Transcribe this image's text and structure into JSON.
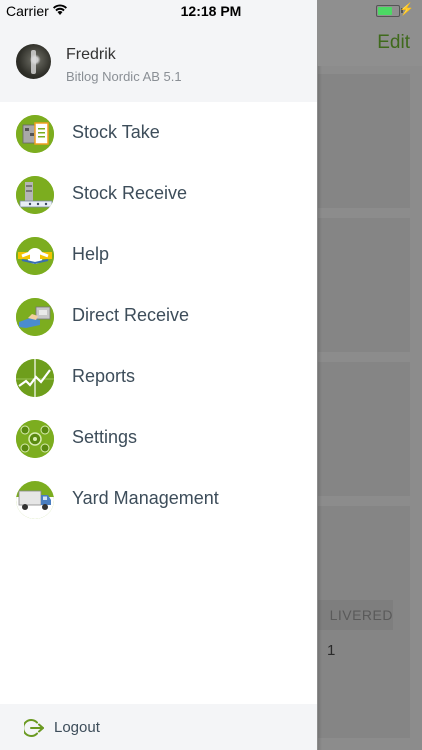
{
  "status_bar": {
    "carrier": "Carrier",
    "time": "12:18 PM"
  },
  "background_app": {
    "edit_label": "Edit",
    "column_label": "LIVERED",
    "count": "1"
  },
  "profile": {
    "name": "Fredrik",
    "company": "Bitlog Nordic AB 5.1"
  },
  "menu": {
    "items": [
      {
        "label": "Stock Take",
        "icon": "stock-take-icon"
      },
      {
        "label": "Stock Receive",
        "icon": "stock-receive-icon"
      },
      {
        "label": "Help",
        "icon": "help-icon"
      },
      {
        "label": "Direct Receive",
        "icon": "direct-receive-icon"
      },
      {
        "label": "Reports",
        "icon": "reports-icon"
      },
      {
        "label": "Settings",
        "icon": "settings-icon"
      },
      {
        "label": "Yard Management",
        "icon": "yard-management-icon"
      }
    ]
  },
  "logout": {
    "label": "Logout",
    "icon": "logout-icon"
  },
  "colors": {
    "accent": "#7cad1f",
    "text": "#3d4d5a",
    "header_bg": "#f4f5f7",
    "edit": "#3f6a1c"
  }
}
